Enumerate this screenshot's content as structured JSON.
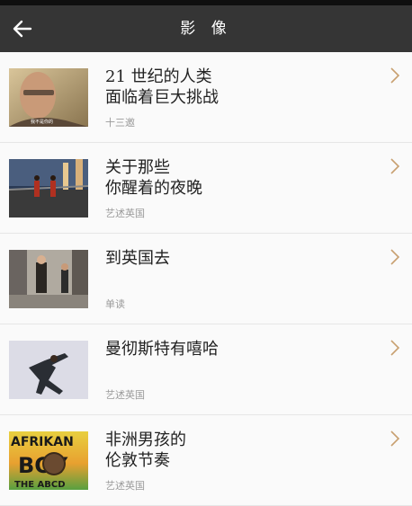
{
  "header": {
    "title": "影 像",
    "back_icon": "arrow-left-icon"
  },
  "items": [
    {
      "line1": "21 世纪的人类",
      "line2": "面临着巨大挑战",
      "source": "十三邀",
      "thumb_caption": "我不是你的"
    },
    {
      "line1": "关于那些",
      "line2": "你醒着的夜晚",
      "source": "艺述英国"
    },
    {
      "line1": "到英国去",
      "line2": "",
      "source": "单读"
    },
    {
      "line1": "曼彻斯特有嘻哈",
      "line2": "",
      "source": "艺述英国"
    },
    {
      "line1": "非洲男孩的",
      "line2": "伦敦节奏",
      "source": "艺述英国",
      "thumb_text1": "AFRIKAN",
      "thumb_text2": "BOY",
      "thumb_text3": "THE ABCD"
    }
  ],
  "colors": {
    "header_bg": "#353535",
    "chevron": "#c8a070",
    "divider": "#e6e6e6"
  }
}
